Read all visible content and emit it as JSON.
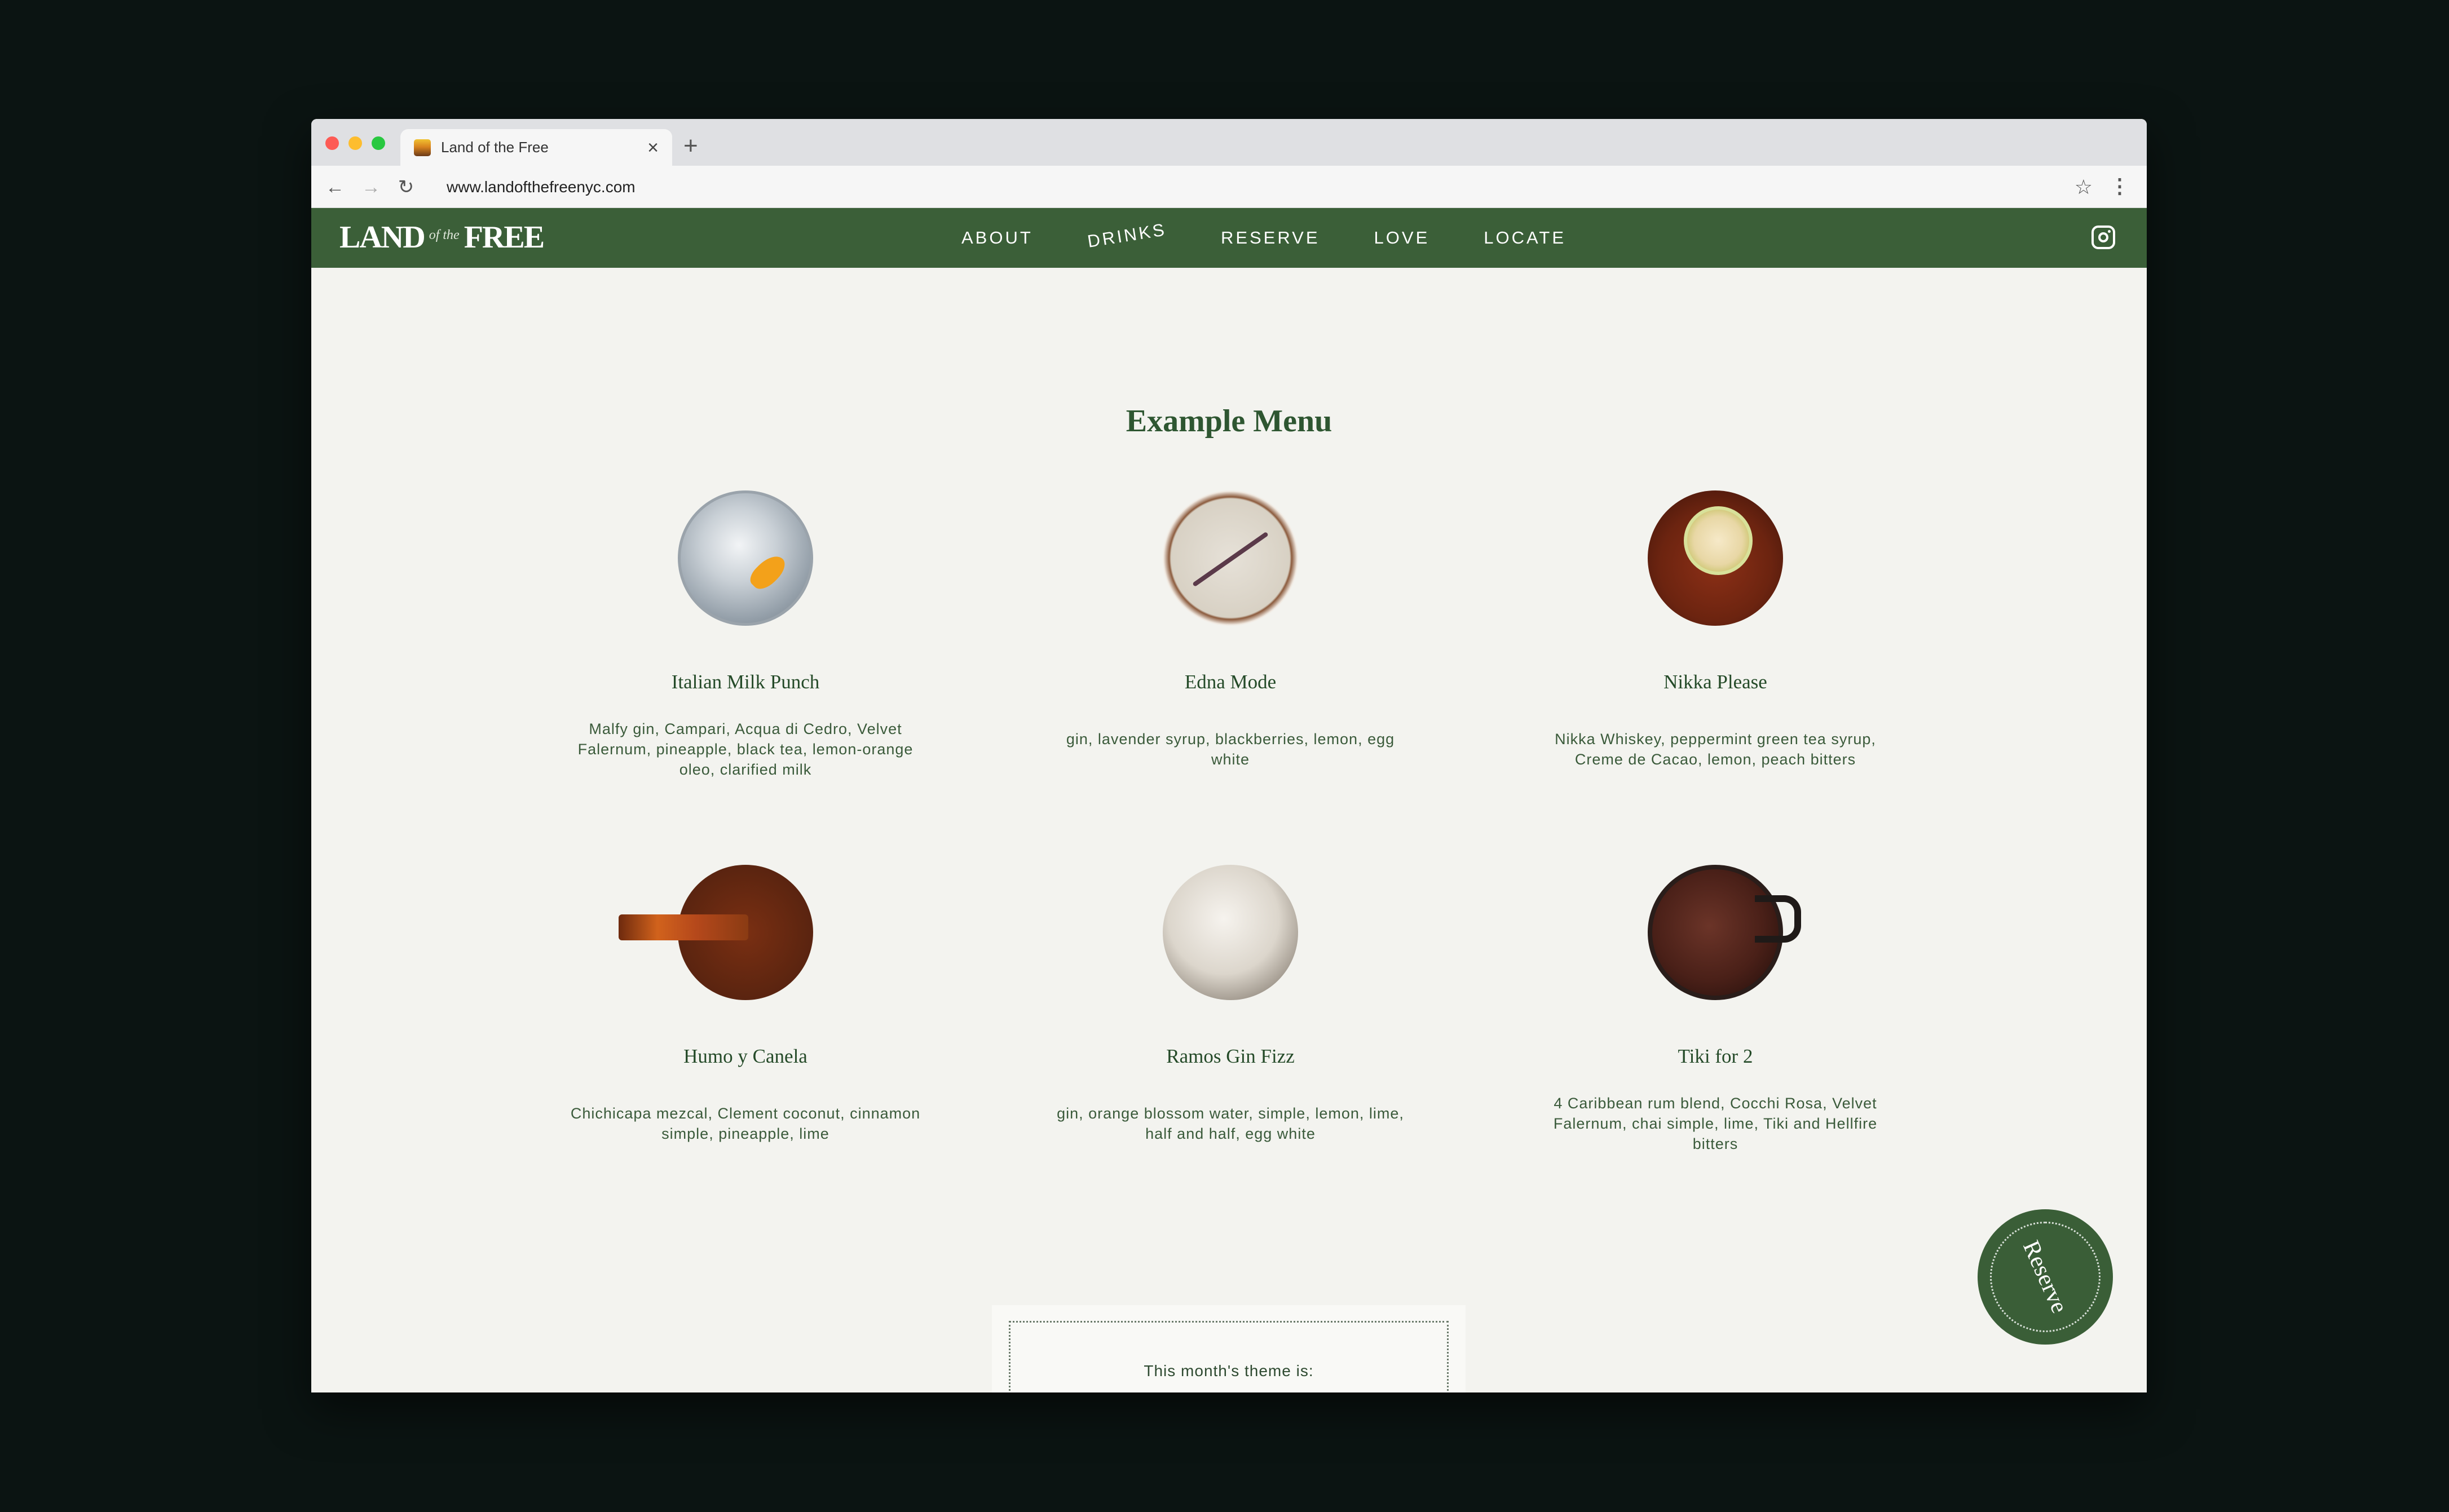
{
  "browser": {
    "tab_title": "Land of the Free",
    "url": "www.landofthefreenyc.com",
    "new_tab_icon": "plus-icon",
    "close_icon": "close-icon"
  },
  "nav": {
    "logo": {
      "part1": "LAND",
      "part2": "of the",
      "part3": "FREE"
    },
    "items": [
      {
        "label": "ABOUT"
      },
      {
        "label": "DRINKS"
      },
      {
        "label": "RESERVE"
      },
      {
        "label": "LOVE"
      },
      {
        "label": "LOCATE"
      }
    ],
    "social_icon": "instagram-icon",
    "brand_color": "#3b5f38"
  },
  "main": {
    "heading": "Example Menu",
    "drinks": [
      {
        "name": "Italian Milk Punch",
        "description": "Malfy gin, Campari, Acqua di Cedro, Velvet Falernum, pineapple, black tea, lemon-orange oleo, clarified milk"
      },
      {
        "name": "Edna Mode",
        "description": "gin, lavender syrup, blackberries, lemon, egg white"
      },
      {
        "name": "Nikka Please",
        "description": "Nikka Whiskey, peppermint green tea syrup, Creme de Cacao, lemon, peach bitters"
      },
      {
        "name": "Humo y Canela",
        "description": "Chichicapa mezcal, Clement coconut, cinnamon simple, pineapple, lime"
      },
      {
        "name": "Ramos Gin Fizz",
        "description": "gin, orange blossom water, simple, lemon, lime, half and half, egg white"
      },
      {
        "name": "Tiki for 2",
        "description": "4 Caribbean rum blend, Cocchi Rosa, Velvet Falernum, chai simple, lime, Tiki and Hellfire bitters"
      }
    ],
    "theme_label": "This month's theme is:"
  },
  "reserve_fab": {
    "label": "Reserve"
  }
}
